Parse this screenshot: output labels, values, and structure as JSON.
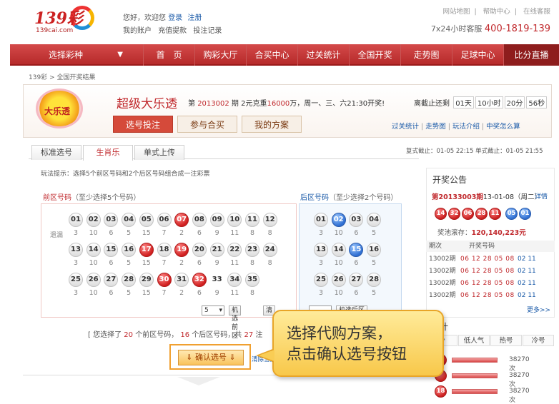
{
  "header": {
    "logo_text": "139彩",
    "logo_domain": "139cai.com",
    "greeting": "您好，欢迎您",
    "login": "登录",
    "register": "注册",
    "account": "我的账户",
    "recharge": "充值提款",
    "bet_record": "投注记录",
    "top_links": [
      "网站地图",
      "帮助中心",
      "在线客服"
    ],
    "hotline_label": "7x24小时客服",
    "hotline_number": "400-1819-139"
  },
  "nav": {
    "select_lottery": "选择彩种",
    "items": [
      "首　页",
      "购彩大厅",
      "合买中心",
      "过关统计",
      "全国开奖",
      "走势图",
      "足球中心",
      "比分直播"
    ]
  },
  "breadcrumb": "139彩 > 全国开奖结果",
  "lottery": {
    "logo_text": "大乐透",
    "title": "超级大乐透",
    "issue_prefix": "第",
    "issue": "2013002",
    "issue_suffix": "期 2元克重",
    "jackpot": "16000",
    "draw_info": "万，周一、三、六21:30开奖!",
    "countdown_label": "离截止还剩",
    "countdown": [
      "01天",
      "10小时",
      "20分",
      "56秒"
    ],
    "tabs": [
      "选号投注",
      "参与合买",
      "我的方案"
    ],
    "links": [
      "过关统计",
      "走势图",
      "玩法介绍",
      "中奖怎么算"
    ]
  },
  "subtabs": [
    "标准选号",
    "生肖乐",
    "单式上传"
  ],
  "deadline": "复式截止：01-05 22:15 单式截止：01-05 21:55",
  "hint": "玩法提示：选择5个前区号码和2个后区号码组合成一注彩票",
  "front": {
    "title": "前区号码",
    "sub": "（至少选择5个号码）",
    "miss_label": "遗漏",
    "rows": [
      {
        "nums": [
          "01",
          "02",
          "03",
          "04",
          "05",
          "06",
          "07",
          "08",
          "09",
          "10",
          "11",
          "12"
        ],
        "miss": [
          "3",
          "10",
          "6",
          "5",
          "15",
          "7",
          "2",
          "6",
          "9",
          "11",
          "8",
          "8"
        ]
      },
      {
        "nums": [
          "13",
          "14",
          "15",
          "16",
          "17",
          "18",
          "19",
          "20",
          "21",
          "22",
          "23",
          "24"
        ],
        "miss": [
          "3",
          "10",
          "6",
          "5",
          "15",
          "7",
          "2",
          "6",
          "9",
          "11",
          "8",
          "8"
        ]
      },
      {
        "nums": [
          "25",
          "26",
          "27",
          "28",
          "29",
          "30",
          "31",
          "32",
          "33",
          "34",
          "35"
        ],
        "miss": [
          "3",
          "10",
          "6",
          "5",
          "15",
          "7",
          "2",
          "6",
          "9",
          "11",
          "8"
        ]
      }
    ],
    "selected": [
      "07",
      "17",
      "19",
      "30",
      "32"
    ],
    "bare": [
      "33"
    ],
    "random_count": "5",
    "random_button": "机选前区",
    "clear_button": "清"
  },
  "back": {
    "title": "后区号码",
    "sub": "（至少选择2个号码）",
    "rows": [
      {
        "nums": [
          "01",
          "02",
          "03",
          "04"
        ],
        "miss": [
          "3",
          "10",
          "6",
          "5"
        ]
      },
      {
        "nums": [
          "13",
          "14",
          "15",
          "16"
        ],
        "miss": [
          "3",
          "10",
          "6",
          "5"
        ]
      },
      {
        "nums": [
          "25",
          "26",
          "27",
          "28"
        ],
        "miss": [
          "3",
          "10",
          "6",
          "5"
        ]
      }
    ],
    "selected": [
      "02",
      "15"
    ],
    "random_button": "机选后区"
  },
  "summary": {
    "t1": "[ 您选择了",
    "front_count": "20",
    "t2": "个前区号码，",
    "back_count": "16",
    "t3": "个后区号码，共",
    "total": "27",
    "t4": "注"
  },
  "confirm_button": "确认选号",
  "clear_all": "清除当前",
  "draw": {
    "title": "开奖公告",
    "issue_label": "第20133003期",
    "issue_date": "13-01-08（周二）",
    "detail": "详情",
    "red": [
      "14",
      "32",
      "06",
      "28",
      "11"
    ],
    "blue": [
      "05",
      "01"
    ],
    "pool_label": "奖池滚存：",
    "pool": "120,140,223元",
    "history_header": [
      "期次",
      "开奖号码"
    ],
    "history": [
      {
        "p": "13002期",
        "n": "06 12 28 05 08",
        "b": "02 11"
      },
      {
        "p": "13002期",
        "n": "06 12 28 05 08",
        "b": "02 11"
      },
      {
        "p": "13002期",
        "n": "06 12 28 05 08",
        "b": "02 11"
      },
      {
        "p": "13002期",
        "n": "06 12 28 05 08",
        "b": "02 11"
      }
    ],
    "more": "更多>>"
  },
  "stats": {
    "title": "统计",
    "tabs": [
      "冷",
      "低人气",
      "热号",
      "冷号"
    ],
    "rows": [
      {
        "num": "",
        "count": "38270次",
        "level": 0.8
      },
      {
        "num": "",
        "count": "38270次",
        "level": 0.8
      },
      {
        "num": "18",
        "count": "38270次",
        "level": 0.8
      }
    ]
  },
  "callout": {
    "line1": "选择代购方案，",
    "line2": "点击确认选号按钮"
  }
}
